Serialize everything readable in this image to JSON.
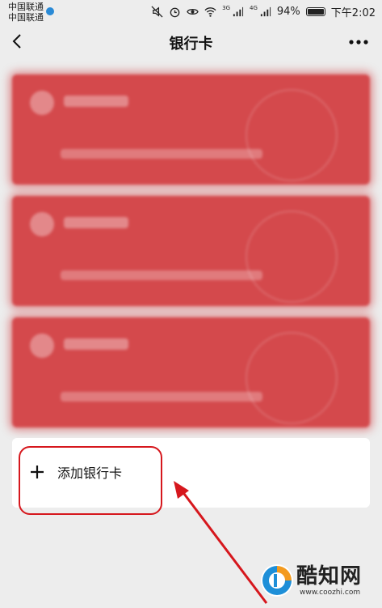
{
  "status_bar": {
    "carrier_line1": "中国联通",
    "carrier_line2": "中国联通",
    "network_3g": "3G",
    "network_4g": "4G",
    "battery": "94%",
    "time": "下午2:02"
  },
  "nav": {
    "title": "银行卡",
    "back_icon": "chevron-left-icon",
    "more_icon": "more-dots-icon"
  },
  "cards": [
    {
      "blurred": true,
      "color": "#d4494c"
    },
    {
      "blurred": true,
      "color": "#d4494c"
    },
    {
      "blurred": true,
      "color": "#d4494c"
    }
  ],
  "add_card": {
    "label": "添加银行卡",
    "icon": "plus-icon"
  },
  "annotation": {
    "color": "#d6171d"
  },
  "watermark": {
    "brand": "酷知网",
    "url": "www.coozhi.com"
  }
}
